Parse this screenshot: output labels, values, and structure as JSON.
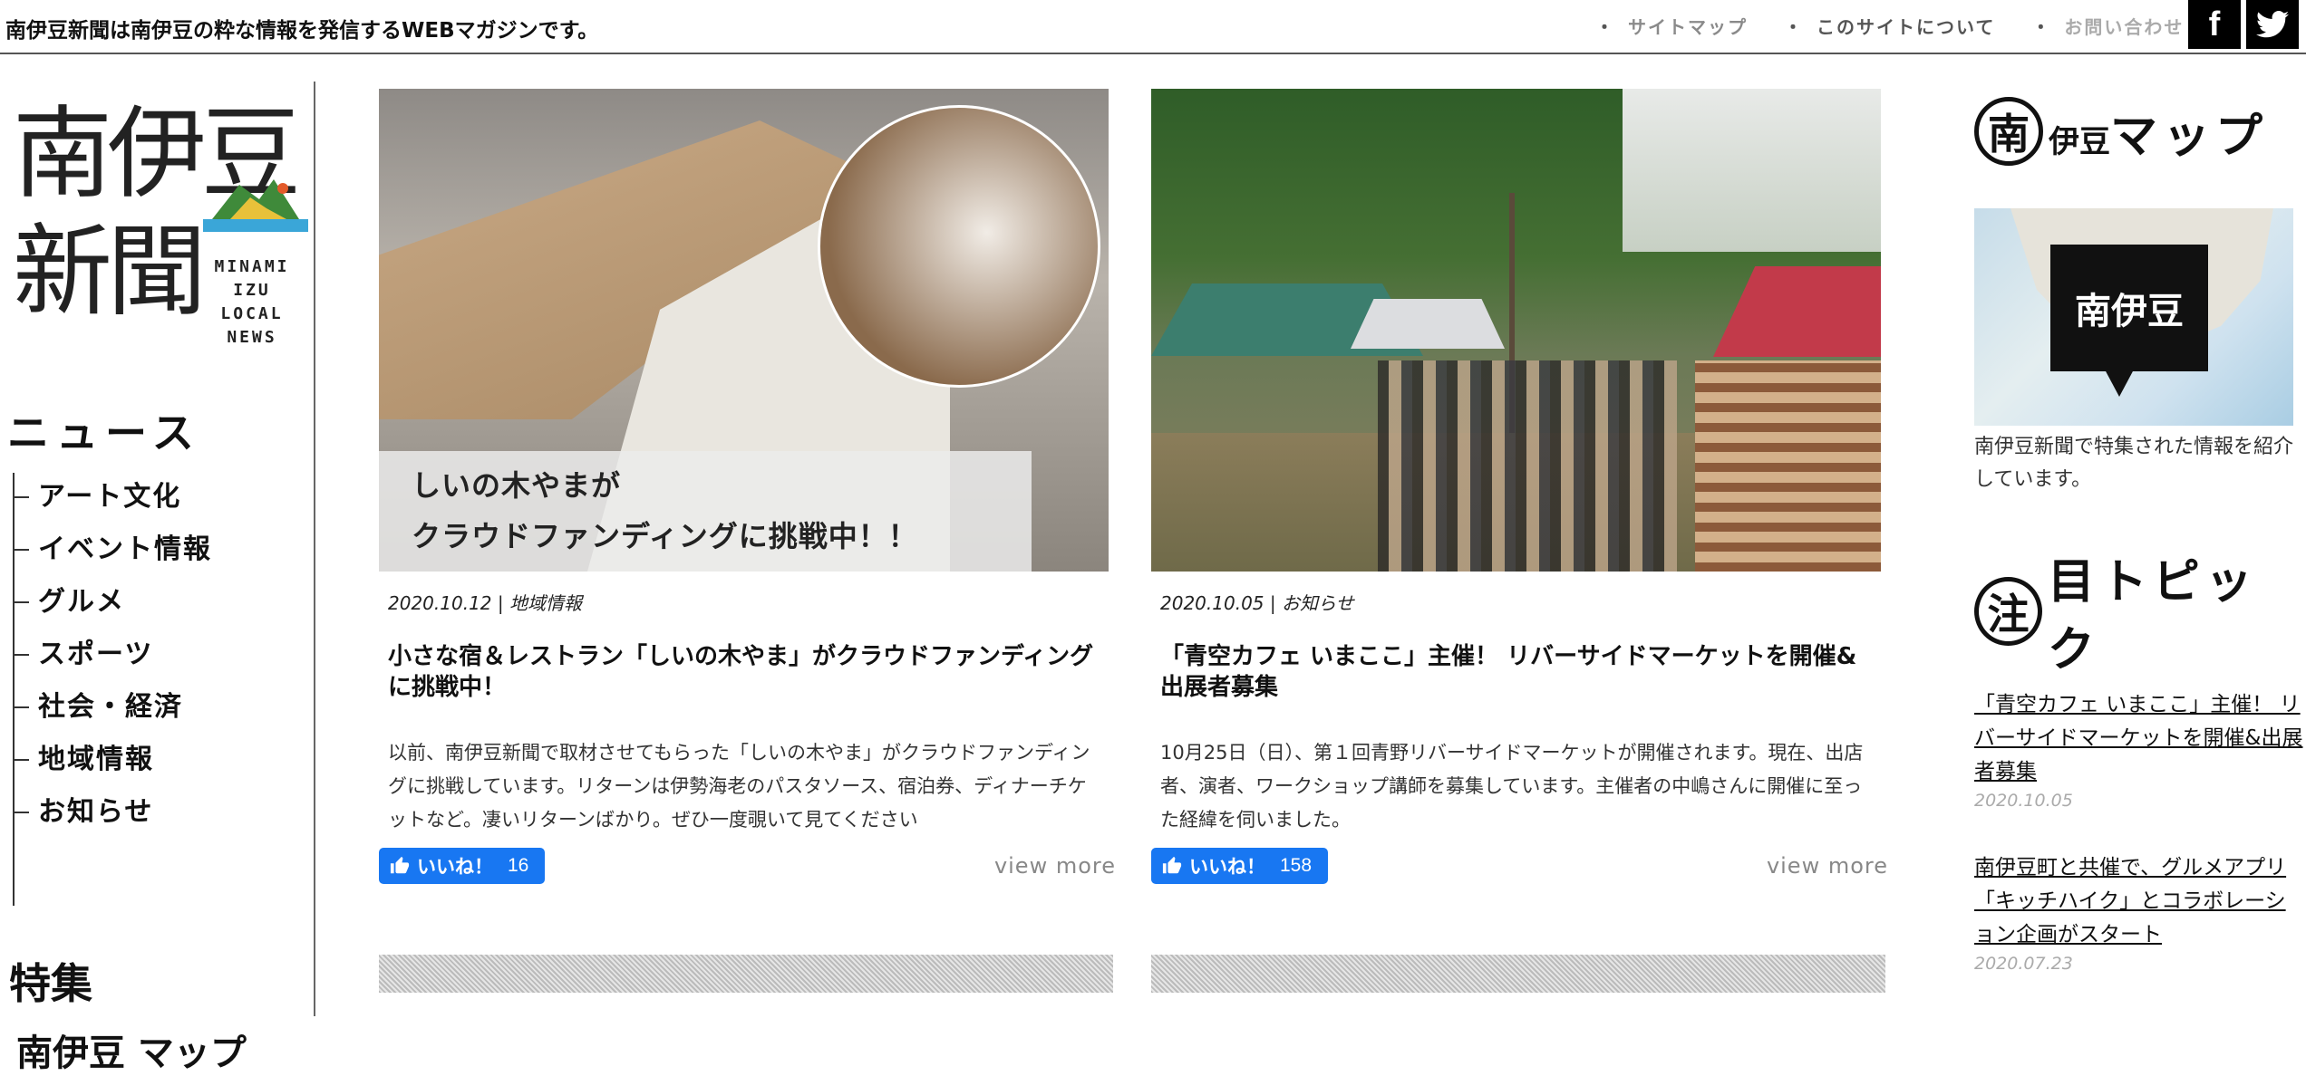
{
  "header": {
    "tagline": "南伊豆新聞は南伊豆の粋な情報を発信するWEBマガジンです。",
    "nav": [
      {
        "label": "サイトマップ"
      },
      {
        "label": "このサイトについて"
      },
      {
        "label": "お問い合わせ"
      }
    ],
    "social": {
      "facebook": "f",
      "twitter_icon": "twitter-bird-icon"
    }
  },
  "sidebar": {
    "logo": {
      "kanji_top": "南伊豆",
      "kanji_bottom": "新聞",
      "en_lines": [
        "MINAMI",
        "IZU",
        "LOCAL",
        "NEWS"
      ]
    },
    "news_heading": "ニュース",
    "news_items": [
      {
        "label": "アート文化"
      },
      {
        "label": "イベント情報"
      },
      {
        "label": "グルメ"
      },
      {
        "label": "スポーツ"
      },
      {
        "label": "社会・経済"
      },
      {
        "label": "地域情報"
      },
      {
        "label": "お知らせ"
      }
    ],
    "special_heading": "特集",
    "special_link": "南伊豆 マップ"
  },
  "articles": [
    {
      "image_caption": [
        "しいの木やまが",
        "クラウドファンディングに挑戦中！！"
      ],
      "date": "2020.10.12",
      "category": "地域情報",
      "title": "小さな宿＆レストラン「しいの木やま」がクラウドファンディングに挑戦中！",
      "excerpt": "以前、南伊豆新聞で取材させてもらった「しいの木やま」がクラウドファンディングに挑戦しています。リターンは伊勢海老のパスタソース、宿泊券、ディナーチケットなど。凄いリターンばかり。ぜひ一度覗いて見てください",
      "like_label": "いいね！",
      "like_count": "16",
      "view_more": "view more"
    },
    {
      "image_caption": [],
      "date": "2020.10.05",
      "category": "お知らせ",
      "title": "「青空カフェ いまここ」主催！ リバーサイドマーケットを開催&出展者募集",
      "excerpt": "10月25日（日）、第１回青野リバーサイドマーケットが開催されます。現在、出店者、演者、ワークショップ講師を募集しています。主催者の中嶋さんに開催に至った経緯を伺いました。",
      "like_label": "いいね！",
      "like_count": "158",
      "view_more": "view more"
    }
  ],
  "right": {
    "map_heading": {
      "circle": "南",
      "small": "伊豆",
      "text": "マップ"
    },
    "map_label": "南伊豆",
    "map_desc": "南伊豆新聞で特集された情報を紹介しています。",
    "topic_heading": {
      "circle": "注",
      "text": "目トピック"
    },
    "topics": [
      {
        "title": "「青空カフェ いまここ」主催！ リバーサイドマーケットを開催&出展者募集",
        "date": "2020.10.05"
      },
      {
        "title": "南伊豆町と共催で、グルメアプリ「キッチハイク」とコラボレーション企画がスタート",
        "date": "2020.07.23"
      }
    ]
  },
  "colors": {
    "like_blue": "#1877f2",
    "text": "#111111",
    "muted": "#888888"
  }
}
